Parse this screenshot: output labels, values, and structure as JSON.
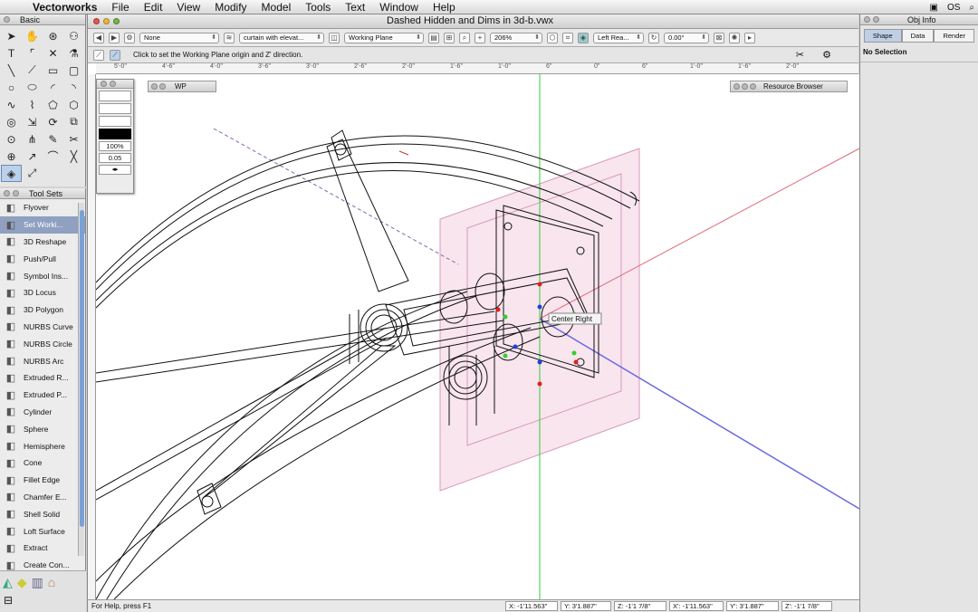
{
  "menubar": {
    "app": "Vectorworks",
    "items": [
      "File",
      "Edit",
      "View",
      "Modify",
      "Model",
      "Tools",
      "Text",
      "Window",
      "Help"
    ]
  },
  "basic_palette": {
    "title": "Basic"
  },
  "toolsets": {
    "title": "Tool Sets",
    "items": [
      {
        "label": "Flyover",
        "icon": "flyover-icon"
      },
      {
        "label": "Set Worki...",
        "icon": "set-working-plane-icon",
        "selected": true
      },
      {
        "label": "3D Reshape",
        "icon": "reshape-icon"
      },
      {
        "label": "Push/Pull",
        "icon": "push-pull-icon"
      },
      {
        "label": "Symbol Ins...",
        "icon": "symbol-icon"
      },
      {
        "label": "3D Locus",
        "icon": "locus-icon"
      },
      {
        "label": "3D Polygon",
        "icon": "polygon-icon"
      },
      {
        "label": "NURBS Curve",
        "icon": "nurbs-curve-icon"
      },
      {
        "label": "NURBS Circle",
        "icon": "nurbs-circle-icon"
      },
      {
        "label": "NURBS Arc",
        "icon": "nurbs-arc-icon"
      },
      {
        "label": "Extruded R...",
        "icon": "extruded-rect-icon"
      },
      {
        "label": "Extruded P...",
        "icon": "extruded-poly-icon"
      },
      {
        "label": "Cylinder",
        "icon": "cylinder-icon"
      },
      {
        "label": "Sphere",
        "icon": "sphere-icon"
      },
      {
        "label": "Hemisphere",
        "icon": "hemisphere-icon"
      },
      {
        "label": "Cone",
        "icon": "cone-icon"
      },
      {
        "label": "Fillet Edge",
        "icon": "fillet-icon"
      },
      {
        "label": "Chamfer E...",
        "icon": "chamfer-icon"
      },
      {
        "label": "Shell Solid",
        "icon": "shell-icon"
      },
      {
        "label": "Loft Surface",
        "icon": "loft-icon"
      },
      {
        "label": "Extract",
        "icon": "extract-icon"
      },
      {
        "label": "Create Con...",
        "icon": "contour-icon"
      }
    ]
  },
  "document": {
    "title": "Dashed Hidden and Dims in 3d-b.vwx",
    "class_value": "None",
    "layer_value": "curtain with elevat...",
    "plane_value": "Working Plane",
    "zoom": "206%",
    "view_value": "Left Rea...",
    "rotation": "0.00°",
    "mode_hint": "Click to set the Working Plane origin and Z' direction.",
    "ruler_ticks": [
      "5'-0\"",
      "4'-6\"",
      "4'-0\"",
      "3'-6\"",
      "3'-0\"",
      "2'-6\"",
      "2'-0\"",
      "1'-6\"",
      "1'-0\"",
      "6\"",
      "0\"",
      "6\"",
      "1'-0\"",
      "1'-6\"",
      "2'-0\""
    ],
    "snap_label": "Center Right"
  },
  "attributes": {
    "zoom": "100%",
    "line_weight": "0.05"
  },
  "floating": {
    "wp_title": "WP",
    "resource_title": "Resource Browser"
  },
  "status": {
    "help": "For Help, press F1",
    "x": "X: -1'11.563\"",
    "y": "Y: 3'1.887\"",
    "z": "Z: -1'1 7/8\"",
    "xp": "X': -1'11.563\"",
    "yp": "Y': 3'1.887\"",
    "zp": "Z': -1'1 7/8\""
  },
  "objinfo": {
    "title": "Obj Info",
    "tabs": [
      "Shape",
      "Data",
      "Render"
    ],
    "selection": "No Selection"
  },
  "colors": {
    "axis_green": "#33cc33",
    "axis_red": "#e06a7a",
    "axis_blue": "#6a6ae0",
    "plane_pink": "#e6a6c6"
  }
}
